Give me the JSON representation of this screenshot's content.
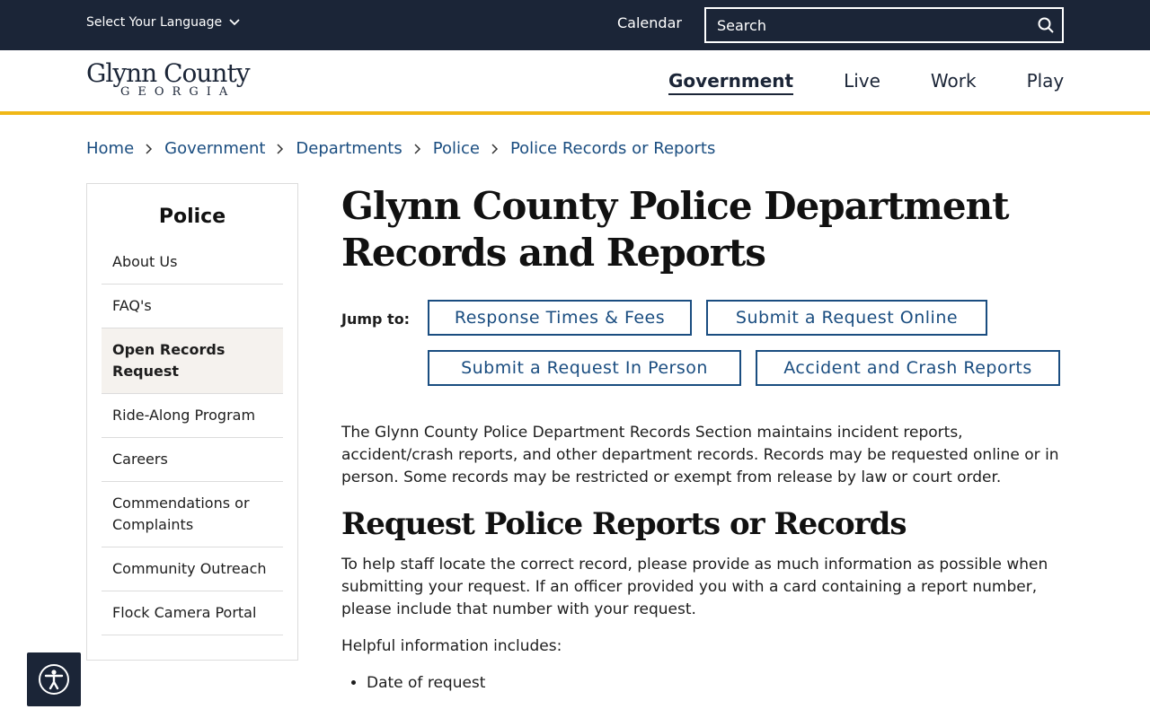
{
  "topbar": {
    "language_label": "Select Your Language",
    "calendar_label": "Calendar",
    "search_placeholder": "Search"
  },
  "header": {
    "logo_line1": "Glynn County",
    "logo_line2": "GEORGIA",
    "nav": [
      {
        "label": "Government",
        "active": true
      },
      {
        "label": "Live"
      },
      {
        "label": "Work"
      },
      {
        "label": "Play"
      }
    ],
    "accent_color": "#f0b716"
  },
  "breadcrumb": [
    "Home",
    "Government",
    "Departments",
    "Police",
    "Police Records or Reports"
  ],
  "sidebar": {
    "title": "Police",
    "items": [
      {
        "label": "About Us"
      },
      {
        "label": "FAQ's"
      },
      {
        "label": "Open Records Request",
        "active": true
      },
      {
        "label": "Ride-Along Program"
      },
      {
        "label": "Careers"
      },
      {
        "label": "Commendations or Complaints"
      },
      {
        "label": "Community Outreach"
      },
      {
        "label": "Flock Camera Portal"
      }
    ]
  },
  "main": {
    "title": "Glynn County Police Department Records and Reports",
    "jump_label": "Jump to:",
    "jump_links": [
      "Response Times & Fees",
      "Submit a Request Online",
      "Submit a Request In Person",
      "Accident and Crash Reports"
    ],
    "intro": "The Glynn County Police Department Records Section maintains incident reports, accident/crash reports, and other department records. Records may be requested online or in person. Some records may be restricted or exempt from release by law or court order.",
    "section_title": "Request Police Reports or Records",
    "section_text": "To help staff locate the correct record, please provide as much information as possible when submitting your request. If an officer provided you with a card containing a report number, please include that number with your request.",
    "helpful_label": "Helpful information includes:",
    "helpful_items": [
      "Date of request"
    ]
  },
  "colors": {
    "dark": "#1b2537",
    "link": "#1a4d80"
  }
}
